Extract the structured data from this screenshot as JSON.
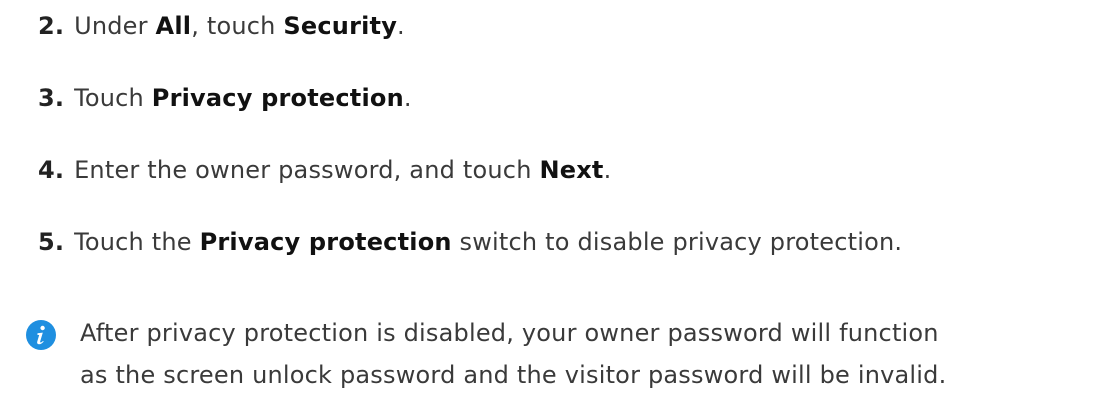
{
  "steps": [
    {
      "number": "2.",
      "parts": [
        "Under ",
        "All",
        ", touch ",
        "Security",
        "."
      ]
    },
    {
      "number": "3.",
      "parts": [
        "Touch ",
        "Privacy protection",
        "."
      ]
    },
    {
      "number": "4.",
      "parts": [
        "Enter the owner password, and touch ",
        "Next",
        "."
      ]
    },
    {
      "number": "5.",
      "parts": [
        "Touch the ",
        "Privacy protection",
        " switch to disable privacy protection."
      ]
    }
  ],
  "note": {
    "icon": "info-icon",
    "icon_color": "#1f8fe0",
    "line1": "After privacy protection is disabled, your owner password will function",
    "line2": "as the screen unlock password and the visitor password will be invalid."
  }
}
